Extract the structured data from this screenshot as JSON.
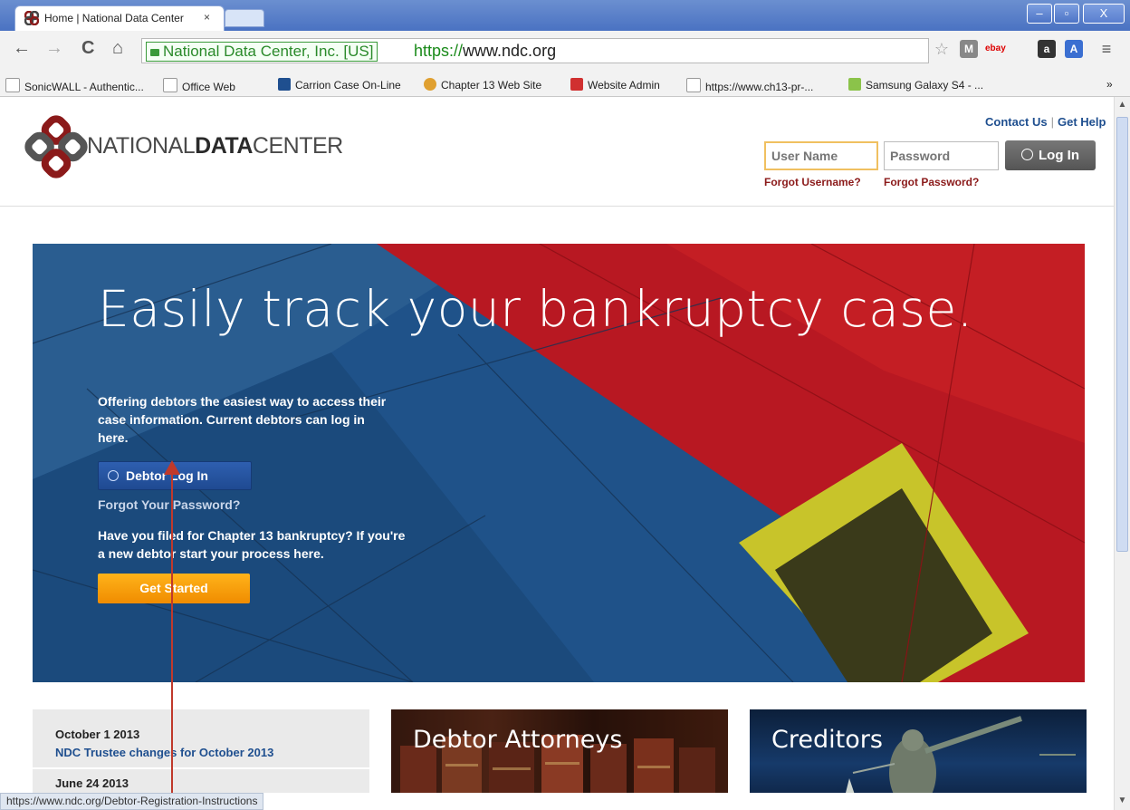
{
  "browser": {
    "tab_title": "Home | National Data Center",
    "tab_close": "×",
    "window_controls": {
      "minimize": "–",
      "maximize": "▫",
      "close": "X"
    },
    "nav": {
      "back": "←",
      "forward": "→",
      "reload": "C",
      "home": "⌂"
    },
    "ev_label": "National Data Center, Inc. [US]",
    "url_scheme": "https://",
    "url_host": "www.ndc.org",
    "bookmarks": [
      {
        "label": "SonicWALL - Authentic...",
        "icon": "page-icon"
      },
      {
        "label": "Office Web",
        "icon": "page-icon"
      },
      {
        "label": "Carrion Case On-Line",
        "icon": "case-icon"
      },
      {
        "label": "Chapter 13 Web Site",
        "icon": "globe-icon"
      },
      {
        "label": "Website Admin",
        "icon": "admin-icon"
      },
      {
        "label": "https://www.ch13-pr-...",
        "icon": "page-icon"
      },
      {
        "label": "Samsung Galaxy S4 - ...",
        "icon": "android-icon"
      }
    ],
    "bookmarks_overflow": "»",
    "status_url": "https://www.ndc.org/Debtor-Registration-Instructions"
  },
  "header": {
    "logo_text_light": "NATIONAL",
    "logo_text_bold": "DATA",
    "logo_text_end": "CENTER",
    "contact": "Contact Us",
    "separator": "|",
    "help": "Get Help",
    "username_placeholder": "User Name",
    "password_placeholder": "Password",
    "login": "Log In",
    "forgot_username": "Forgot Username?",
    "forgot_password": "Forgot Password?"
  },
  "hero": {
    "headline": "Easily track your bankruptcy case.",
    "intro": "Offering debtors the easiest way to access their case information. Current debtors can log in here.",
    "debtor_login": "Debtor Log In",
    "forgot_link": "Forgot Your Password?",
    "chapter13": "Have you filed for Chapter 13 bankruptcy? If you're a new debtor start your process here.",
    "get_started": "Get Started"
  },
  "news": [
    {
      "date": "October 1 2013",
      "title": "NDC Trustee changes for October 2013"
    },
    {
      "date": "June 24 2013",
      "title": ""
    }
  ],
  "cards": [
    {
      "title": "Debtor Attorneys"
    },
    {
      "title": "Creditors"
    }
  ],
  "colors": {
    "brand_red": "#8b1a1a",
    "link_blue": "#1f4f8f",
    "orange": "#f5a000",
    "hero_blue": "#1e4f84",
    "hero_red": "#c1171f"
  }
}
